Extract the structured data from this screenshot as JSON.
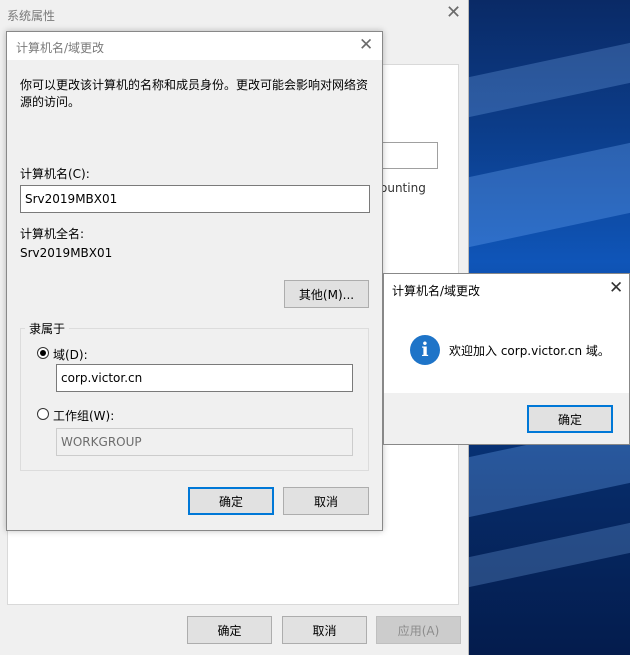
{
  "system_window": {
    "title": "系统属性",
    "close_glyph": "✕",
    "field_fragment": "ounting",
    "ok_label": "确定",
    "cancel_label": "取消",
    "apply_label": "应用(A)"
  },
  "rename_dialog": {
    "title": "计算机名/域更改",
    "close_glyph": "✕",
    "description": "你可以更改该计算机的名称和成员身份。更改可能会影响对网络资源的访问。",
    "computer_name_label": "计算机名(C):",
    "computer_name_value": "Srv2019MBX01",
    "full_name_label": "计算机全名:",
    "full_name_value": "Srv2019MBX01",
    "more_button": "其他(M)...",
    "member_of_label": "隶属于",
    "domain_radio_label": "域(D):",
    "domain_value": "corp.victor.cn",
    "workgroup_radio_label": "工作组(W):",
    "workgroup_value": "WORKGROUP",
    "ok_label": "确定",
    "cancel_label": "取消",
    "selected_option": "domain"
  },
  "message_box": {
    "title": "计算机名/域更改",
    "close_glyph": "✕",
    "icon": "info-icon",
    "icon_glyph": "i",
    "message": "欢迎加入 corp.victor.cn 域。",
    "ok_label": "确定"
  },
  "colors": {
    "accent": "#0078d7",
    "info_icon": "#1e74c8"
  }
}
